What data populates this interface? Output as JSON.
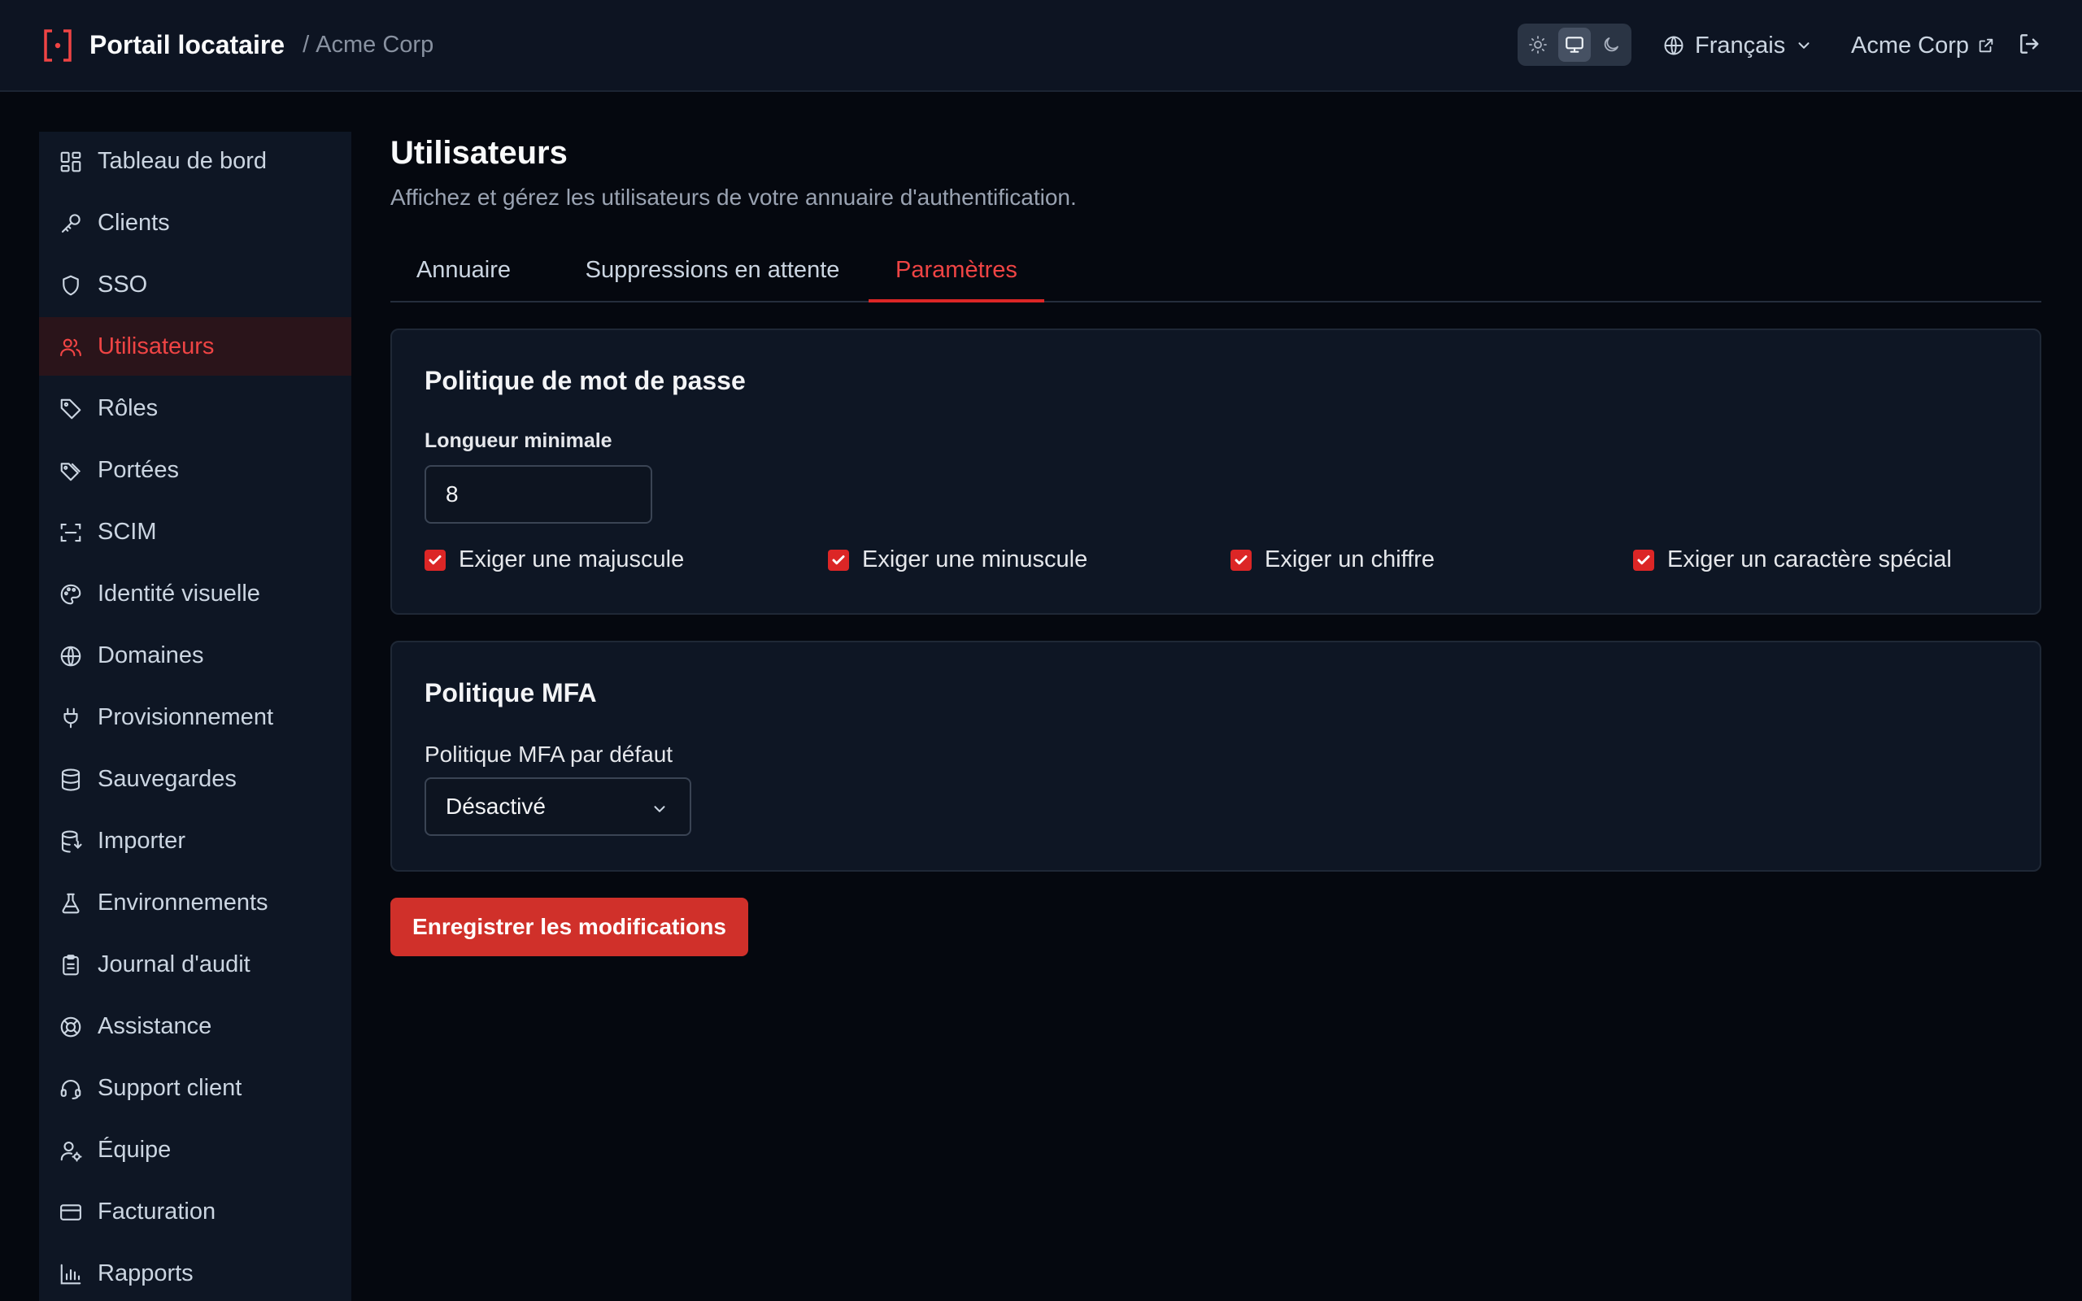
{
  "header": {
    "app_title": "Portail locataire",
    "separator": "/",
    "tenant": "Acme Corp",
    "theme_options": [
      "light",
      "system",
      "dark"
    ],
    "theme_selected": "system",
    "language": "Français",
    "tenant_link": "Acme Corp"
  },
  "sidebar": {
    "items": [
      {
        "label": "Tableau de bord",
        "icon": "dashboard-icon"
      },
      {
        "label": "Clients",
        "icon": "key-icon"
      },
      {
        "label": "SSO",
        "icon": "shield-icon"
      },
      {
        "label": "Utilisateurs",
        "icon": "users-icon",
        "active": true
      },
      {
        "label": "Rôles",
        "icon": "tag-icon"
      },
      {
        "label": "Portées",
        "icon": "tags-icon"
      },
      {
        "label": "SCIM",
        "icon": "scan-icon"
      },
      {
        "label": "Identité visuelle",
        "icon": "palette-icon"
      },
      {
        "label": "Domaines",
        "icon": "globe-icon"
      },
      {
        "label": "Provisionnement",
        "icon": "plug-icon"
      },
      {
        "label": "Sauvegardes",
        "icon": "database-icon"
      },
      {
        "label": "Importer",
        "icon": "database-import-icon"
      },
      {
        "label": "Environnements",
        "icon": "flask-icon"
      },
      {
        "label": "Journal d'audit",
        "icon": "clipboard-icon"
      },
      {
        "label": "Assistance",
        "icon": "lifebuoy-icon"
      },
      {
        "label": "Support client",
        "icon": "headset-icon"
      },
      {
        "label": "Équipe",
        "icon": "user-cog-icon"
      },
      {
        "label": "Facturation",
        "icon": "credit-card-icon"
      },
      {
        "label": "Rapports",
        "icon": "bar-chart-icon"
      }
    ]
  },
  "main": {
    "title": "Utilisateurs",
    "subtitle": "Affichez et gérez les utilisateurs de votre annuaire d'authentification.",
    "tabs": [
      {
        "label": "Annuaire"
      },
      {
        "label": "Suppressions en attente"
      },
      {
        "label": "Paramètres",
        "active": true
      }
    ],
    "password_policy": {
      "title": "Politique de mot de passe",
      "min_length_label": "Longueur minimale",
      "min_length_value": "8",
      "checks": [
        {
          "label": "Exiger une majuscule",
          "checked": true
        },
        {
          "label": "Exiger une minuscule",
          "checked": true
        },
        {
          "label": "Exiger un chiffre",
          "checked": true
        },
        {
          "label": "Exiger un caractère spécial",
          "checked": true
        }
      ]
    },
    "mfa_policy": {
      "title": "Politique MFA",
      "default_label": "Politique MFA par défaut",
      "default_value": "Désactivé"
    },
    "save_label": "Enregistrer les modifications"
  },
  "colors": {
    "accent": "#dc2626",
    "background": "#05080f",
    "surface": "#0e1624"
  }
}
